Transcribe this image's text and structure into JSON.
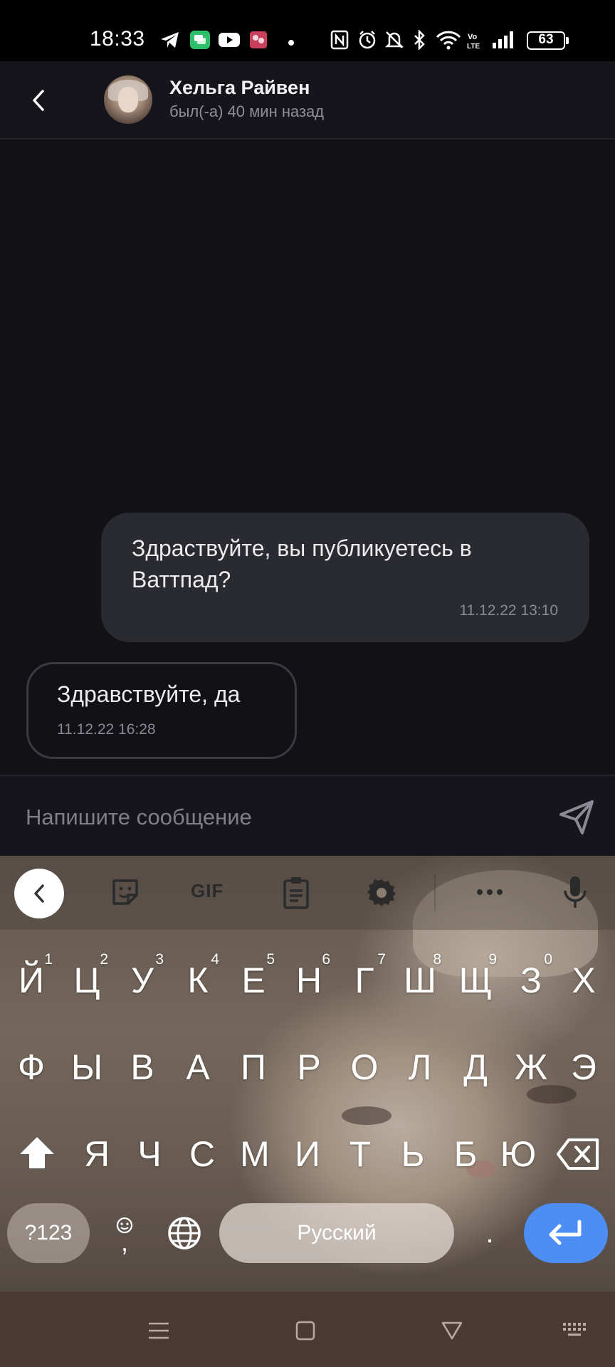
{
  "status_bar": {
    "time": "18:33",
    "battery": "63",
    "icons": [
      "telegram-icon",
      "messages-icon",
      "youtube-icon",
      "app-icon",
      "dot-icon",
      "nfc-icon",
      "alarm-icon",
      "mute-icon",
      "bluetooth-icon",
      "wifi-icon",
      "volte-icon",
      "signal-icon",
      "battery-icon"
    ]
  },
  "header": {
    "contact_name": "Хельга Райвен",
    "contact_status": "был(-а) 40 мин назад"
  },
  "messages": [
    {
      "direction": "outgoing",
      "text": "Здраствуйте, вы публикуетесь в Ваттпад?",
      "time": "11.12.22 13:10"
    },
    {
      "direction": "incoming",
      "text": "Здравствуйте, да",
      "time": "11.12.22 16:28"
    }
  ],
  "composer": {
    "placeholder": "Напишите сообщение"
  },
  "keyboard": {
    "toolbar": {
      "gif_label": "GIF",
      "tools": [
        "collapse-icon",
        "sticker-icon",
        "gif-icon",
        "clipboard-icon",
        "settings-icon",
        "more-icon",
        "mic-icon"
      ]
    },
    "row1": [
      {
        "key": "Й",
        "hint": "1"
      },
      {
        "key": "Ц",
        "hint": "2"
      },
      {
        "key": "У",
        "hint": "3"
      },
      {
        "key": "К",
        "hint": "4"
      },
      {
        "key": "Е",
        "hint": "5"
      },
      {
        "key": "Н",
        "hint": "6"
      },
      {
        "key": "Г",
        "hint": "7"
      },
      {
        "key": "Ш",
        "hint": "8"
      },
      {
        "key": "Щ",
        "hint": "9"
      },
      {
        "key": "З",
        "hint": "0"
      },
      {
        "key": "Х",
        "hint": ""
      }
    ],
    "row2": [
      "Ф",
      "Ы",
      "В",
      "А",
      "П",
      "Р",
      "О",
      "Л",
      "Д",
      "Ж",
      "Э"
    ],
    "row3": [
      "Я",
      "Ч",
      "С",
      "М",
      "И",
      "Т",
      "Ь",
      "Б",
      "Ю"
    ],
    "symbols_label": "?123",
    "comma_label": ",",
    "space_label": "Русский",
    "period_label": ".",
    "accent_color": "#4c8ef4"
  },
  "nav_bar": {
    "buttons": [
      "menu-icon",
      "home-icon",
      "back-icon",
      "keyboard-icon"
    ]
  }
}
